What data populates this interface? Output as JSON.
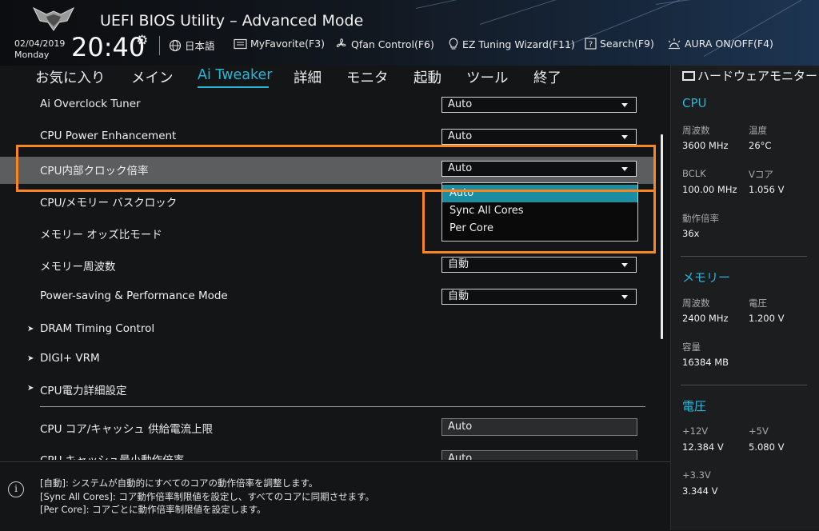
{
  "header": {
    "title": "UEFI BIOS Utility – Advanced Mode",
    "date": "02/04/2019",
    "day": "Monday",
    "time": "20:40",
    "tools": [
      {
        "icon": "globe-icon",
        "label": "日本語"
      },
      {
        "icon": "favorite-icon",
        "label": "MyFavorite(F3)"
      },
      {
        "icon": "fan-icon",
        "label": "Qfan Control(F6)"
      },
      {
        "icon": "lightbulb-icon",
        "label": "EZ Tuning Wizard(F11)"
      },
      {
        "icon": "search-icon",
        "label": "Search(F9)"
      },
      {
        "icon": "aura-icon",
        "label": "AURA ON/OFF(F4)"
      }
    ]
  },
  "tabs": [
    "お気に入り",
    "メイン",
    "Ai Tweaker",
    "詳細",
    "モニタ",
    "起動",
    "ツール",
    "終了"
  ],
  "active_tab": "Ai Tweaker",
  "settings": [
    {
      "label": "Ai Overclock Tuner",
      "value": "Auto"
    },
    {
      "label": "CPU Power Enhancement",
      "value": "Auto"
    },
    {
      "label": "CPU内部クロック倍率",
      "value": "Auto"
    },
    {
      "label": "CPU/メモリー バスクロック",
      "value": ""
    },
    {
      "label": "メモリー オッズ比モード",
      "value": ""
    },
    {
      "label": "メモリー周波数",
      "value": "自動"
    },
    {
      "label": "Power-saving & Performance Mode",
      "value": "自動"
    },
    {
      "label": "DRAM Timing Control"
    },
    {
      "label": "DIGI+ VRM"
    },
    {
      "label": "CPU電力詳細設定"
    },
    {
      "label": "CPU コア/キャッシュ 供給電流上限",
      "value": "Auto"
    },
    {
      "label": "CPU キャッシュ最小動作倍率",
      "value": "Auto"
    }
  ],
  "dropdown": {
    "options": [
      "Auto",
      "Sync All Cores",
      "Per Core"
    ],
    "highlighted": "Auto"
  },
  "help": {
    "lines": [
      "[自動]: システムが自動的にすべてのコアの動作倍率を調整します。",
      "[Sync All Cores]: コア動作倍率制限値を設定し、すべてのコアに同期させます。",
      "[Per Core]: コアごとに動作倍率制限値を設定します。"
    ]
  },
  "monitor": {
    "title": "ハードウェアモニター",
    "cpu": {
      "title": "CPU",
      "freq_label": "周波数",
      "freq_value": "3600 MHz",
      "temp_label": "温度",
      "temp_value": "26°C",
      "bclk_label": "BCLK",
      "bclk_value": "100.00 MHz",
      "vcore_label": "Vコア",
      "vcore_value": "1.056 V",
      "ratio_label": "動作倍率",
      "ratio_value": "36x"
    },
    "memory": {
      "title": "メモリー",
      "freq_label": "周波数",
      "freq_value": "2400 MHz",
      "volt_label": "電圧",
      "volt_value": "1.200 V",
      "cap_label": "容量",
      "cap_value": "16384 MB"
    },
    "voltage": {
      "title": "電圧",
      "v12_label": "+12V",
      "v12_value": "12.384 V",
      "v5_label": "+5V",
      "v5_value": "5.080 V",
      "v33_label": "+3.3V",
      "v33_value": "3.344 V"
    }
  },
  "colors": {
    "accent": "#27b6d8",
    "highlight_box": "#f68522",
    "dropdown_selected": "#1b8da2"
  }
}
